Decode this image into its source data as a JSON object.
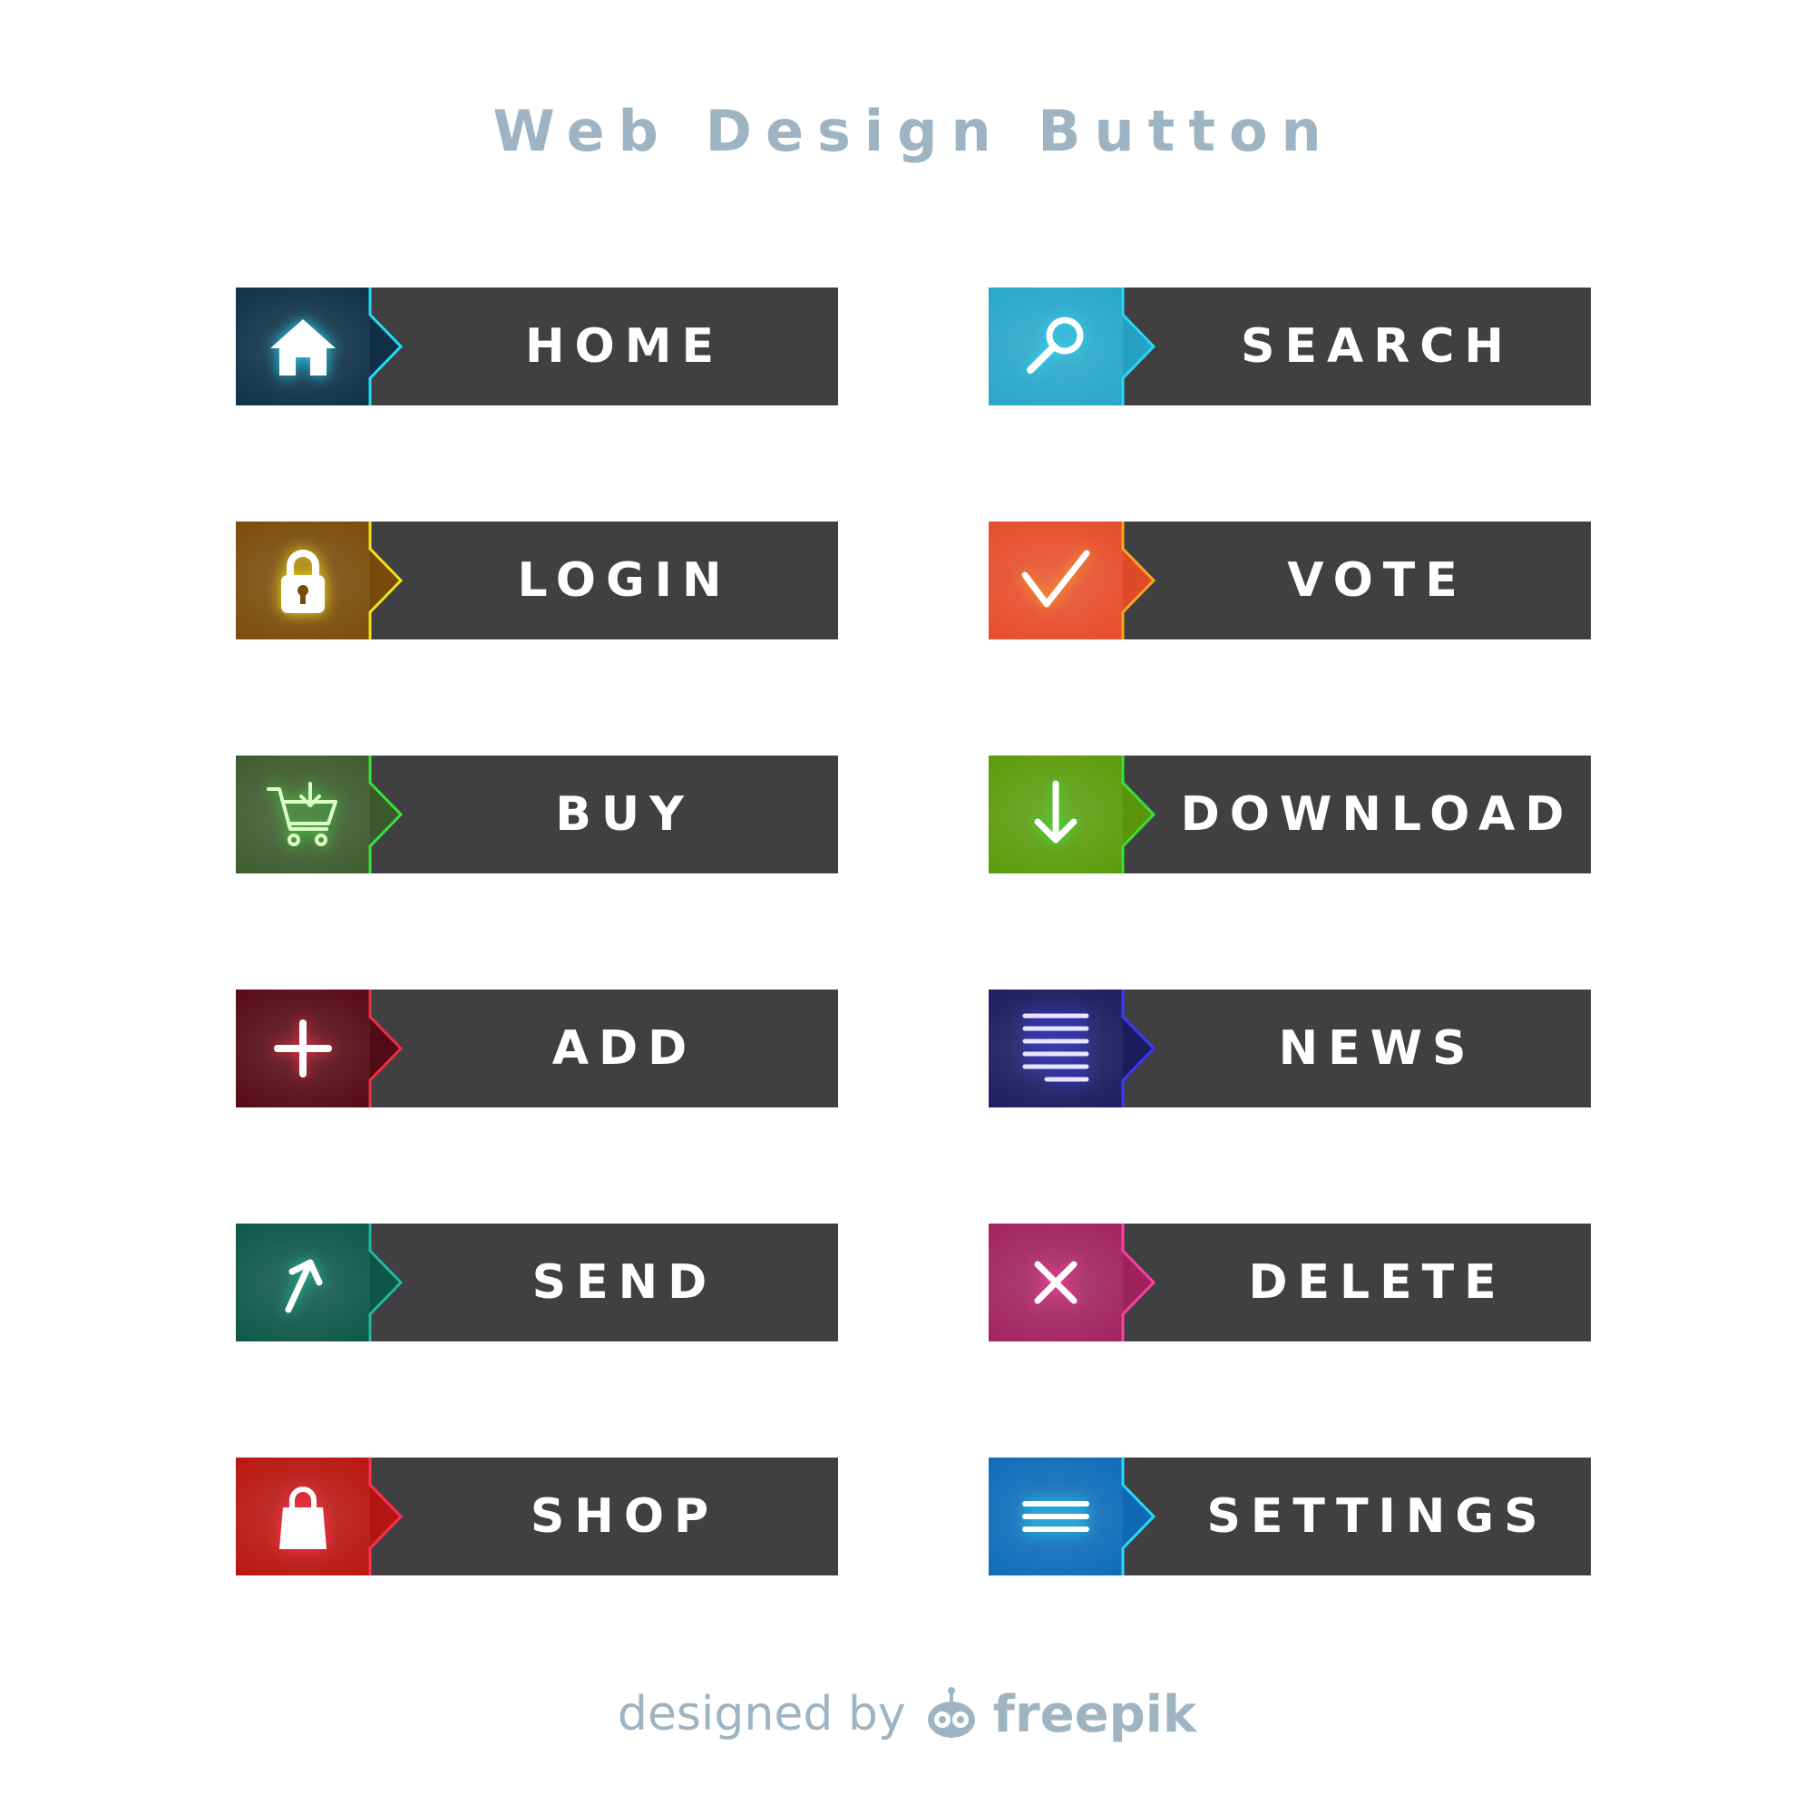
{
  "title": "Web Design Button",
  "buttons": [
    {
      "label": "HOME",
      "icon": "home-icon",
      "color": "#0c2f44",
      "accent": "#26d9f6"
    },
    {
      "label": "SEARCH",
      "icon": "search-icon",
      "color": "#25a5c8",
      "accent": "#26d9f6"
    },
    {
      "label": "LOGIN",
      "icon": "lock-icon",
      "color": "#7a4a08",
      "accent": "#f2e21c"
    },
    {
      "label": "VOTE",
      "icon": "checkmark-icon",
      "color": "#e64b28",
      "accent": "#f5a623"
    },
    {
      "label": "BUY",
      "icon": "cart-icon",
      "color": "#3c5a2c",
      "accent": "#38e23a"
    },
    {
      "label": "DOWNLOAD",
      "icon": "download-arrow-icon",
      "color": "#5a9a08",
      "accent": "#38e23a"
    },
    {
      "label": "ADD",
      "icon": "plus-icon",
      "color": "#540814",
      "accent": "#f03040"
    },
    {
      "label": "NEWS",
      "icon": "news-lines-icon",
      "color": "#1a1a5e",
      "accent": "#3a3aff"
    },
    {
      "label": "SEND",
      "icon": "send-arrow-icon",
      "color": "#0b5646",
      "accent": "#1fb8a0"
    },
    {
      "label": "DELETE",
      "icon": "close-icon",
      "color": "#a1205e",
      "accent": "#ff3ea0"
    },
    {
      "label": "SHOP",
      "icon": "shopping-bag-icon",
      "color": "#b8140e",
      "accent": "#ff3050"
    },
    {
      "label": "SETTINGS",
      "icon": "menu-icon",
      "color": "#0b6ab8",
      "accent": "#26d9f6"
    }
  ],
  "footer": {
    "designed_by": "designed by",
    "brand": "freepik",
    "logo_icon": "freepik-logo-icon"
  }
}
